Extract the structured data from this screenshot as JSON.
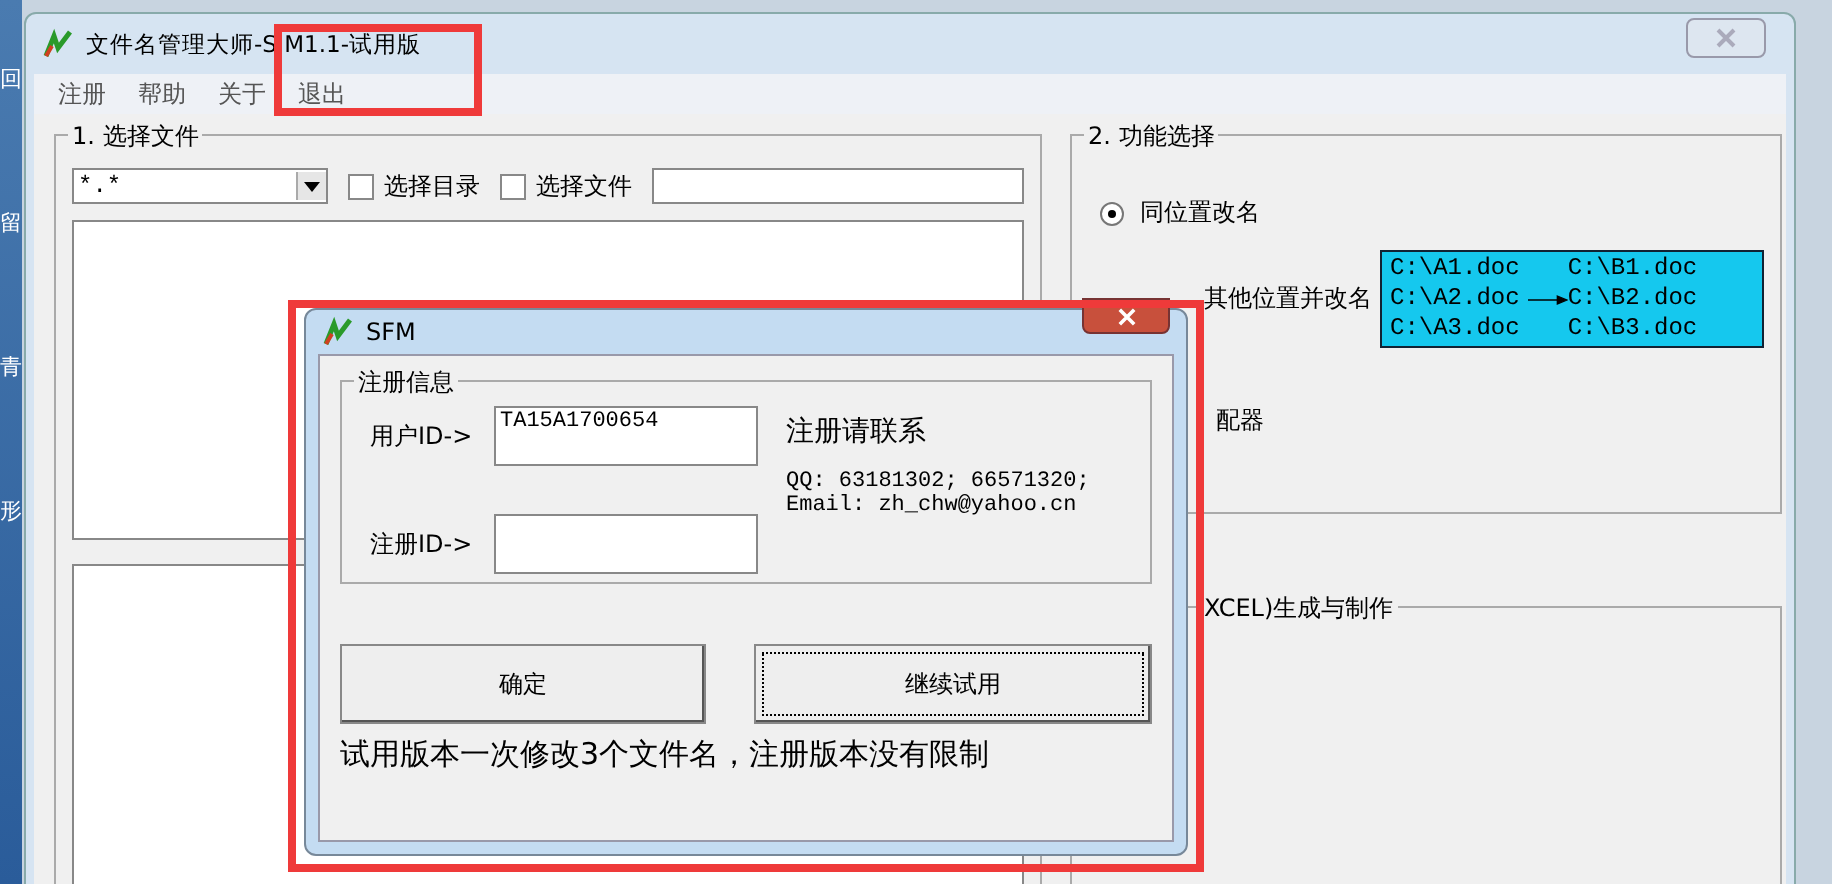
{
  "desktop_labels": [
    "回",
    "留",
    "青",
    "形"
  ],
  "window": {
    "title": "文件名管理大师-S M1.1-试用版"
  },
  "menu": [
    "注册",
    "帮助",
    "关于",
    "退出"
  ],
  "file_group": {
    "title": "1. 选择文件",
    "filter": "*.*",
    "options": [
      {
        "label": "选择目录",
        "checked": false
      },
      {
        "label": "选择文件",
        "checked": false
      }
    ]
  },
  "function_group": {
    "title": "2. 功能选择",
    "options": [
      {
        "label": "同位置改名",
        "selected": true
      }
    ],
    "covered_option_label": "其他位置并改名",
    "preview_lines": [
      {
        "from": "C:\\A1.doc",
        "to": "C:\\B1.doc",
        "arrow": false
      },
      {
        "from": "C:\\A2.doc",
        "to": "C:\\B2.doc",
        "arrow": true
      },
      {
        "from": "C:\\A3.doc",
        "to": "C:\\B3.doc",
        "arrow": false
      }
    ],
    "partial_label": "配器"
  },
  "excel_group": {
    "title": "XCEL)生成与制作"
  },
  "dialog": {
    "title": "SFM",
    "group_title": "注册信息",
    "fields": [
      {
        "label": "用户ID->",
        "value": "TA15A1700654"
      },
      {
        "label": "注册ID->"
      }
    ],
    "contact_title": "注册请联系",
    "contact_lines": [
      "QQ: 63181302; 66571320;",
      "Email: zh_chw@yahoo.cn"
    ],
    "buttons": [
      {
        "label": "确定",
        "focused": false
      },
      {
        "label": "继续试用",
        "focused": true
      }
    ],
    "note": "试用版本一次修改3个文件名，注册版本没有限制"
  }
}
